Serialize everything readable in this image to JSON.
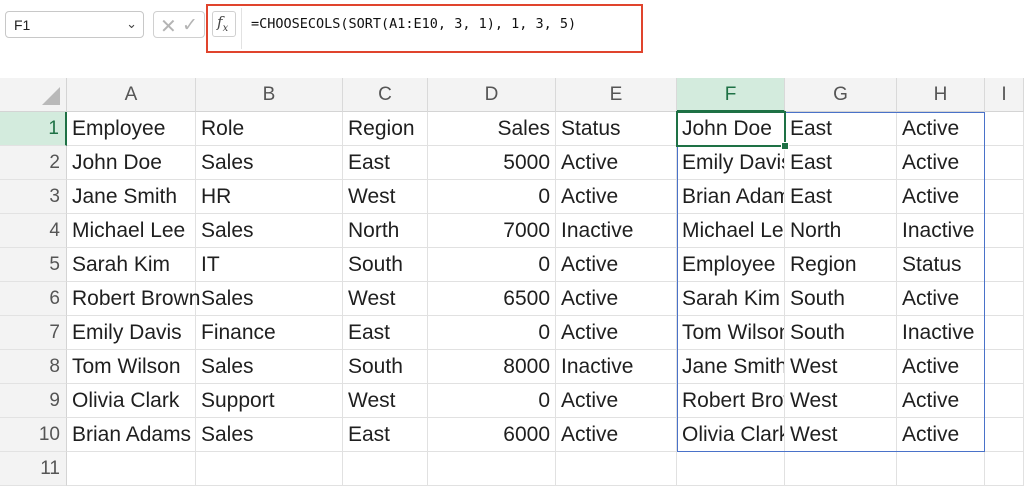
{
  "formula_bar": {
    "name_box": "F1",
    "formula": "=CHOOSECOLS(SORT(A1:E10, 3, 1), 1, 3, 5)",
    "fx_label": "fx",
    "cancel_icon": "close-icon",
    "enter_icon": "checkmark-icon",
    "highlight_color": "#e0442d"
  },
  "grid": {
    "columns": [
      "A",
      "B",
      "C",
      "D",
      "E",
      "F",
      "G",
      "H",
      "I"
    ],
    "selected_column": "F",
    "selected_row": 1,
    "rows": [
      {
        "num": "1",
        "A": "Employee",
        "B": "Role",
        "C": "Region",
        "D": "Sales",
        "E": "Status",
        "F": "John Doe",
        "G": "East",
        "H": "Active"
      },
      {
        "num": "2",
        "A": "John Doe",
        "B": "Sales",
        "C": "East",
        "D": "5000",
        "E": "Active",
        "F": "Emily Davis",
        "G": "East",
        "H": "Active"
      },
      {
        "num": "3",
        "A": "Jane Smith",
        "B": "HR",
        "C": "West",
        "D": "0",
        "E": "Active",
        "F": "Brian Adams",
        "G": "East",
        "H": "Active"
      },
      {
        "num": "4",
        "A": "Michael Lee",
        "B": "Sales",
        "C": "North",
        "D": "7000",
        "E": "Inactive",
        "F": "Michael Lee",
        "G": "North",
        "H": "Inactive"
      },
      {
        "num": "5",
        "A": "Sarah Kim",
        "B": "IT",
        "C": "South",
        "D": "0",
        "E": "Active",
        "F": "Employee",
        "G": "Region",
        "H": "Status"
      },
      {
        "num": "6",
        "A": "Robert Brown",
        "B": "Sales",
        "C": "West",
        "D": "6500",
        "E": "Active",
        "F": "Sarah Kim",
        "G": "South",
        "H": "Active"
      },
      {
        "num": "7",
        "A": "Emily Davis",
        "B": "Finance",
        "C": "East",
        "D": "0",
        "E": "Active",
        "F": "Tom Wilson",
        "G": "South",
        "H": "Inactive"
      },
      {
        "num": "8",
        "A": "Tom Wilson",
        "B": "Sales",
        "C": "South",
        "D": "8000",
        "E": "Inactive",
        "F": "Jane Smith",
        "G": "West",
        "H": "Active"
      },
      {
        "num": "9",
        "A": "Olivia Clark",
        "B": "Support",
        "C": "West",
        "D": "0",
        "E": "Active",
        "F": "Robert Brown",
        "G": "West",
        "H": "Active"
      },
      {
        "num": "10",
        "A": "Brian Adams",
        "B": "Sales",
        "C": "East",
        "D": "6000",
        "E": "Active",
        "F": "Olivia Clark",
        "G": "West",
        "H": "Active"
      },
      {
        "num": "11",
        "A": "",
        "B": "",
        "C": "",
        "D": "",
        "E": "",
        "F": "",
        "G": "",
        "H": ""
      }
    ],
    "selection_color": "#1e7145",
    "spill_border_color": "#4a72c9"
  }
}
